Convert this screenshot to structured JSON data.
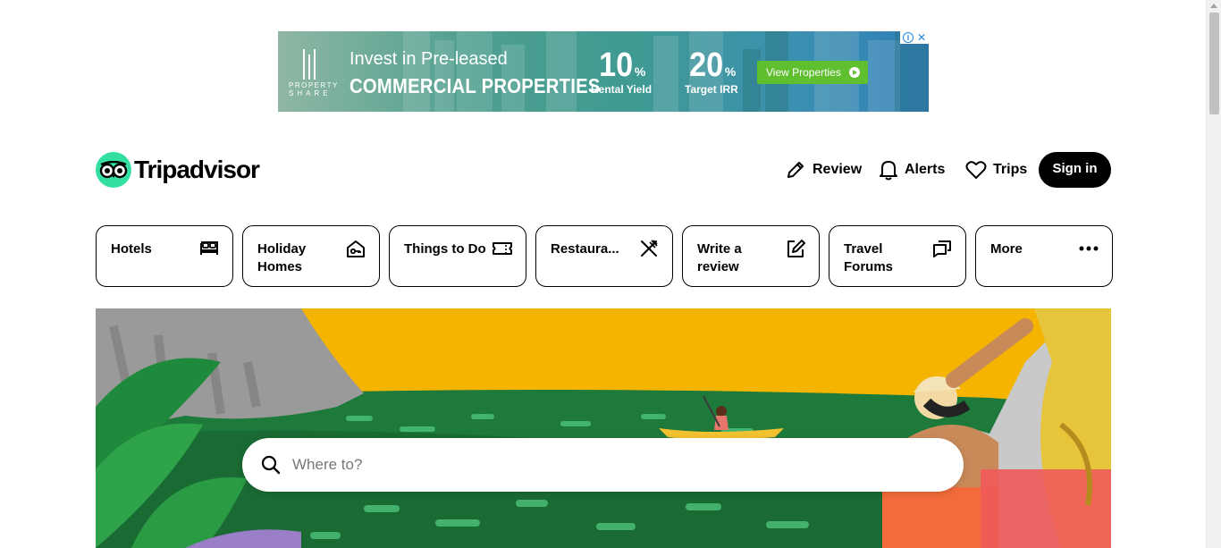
{
  "ad": {
    "line1": "Invest in Pre-leased",
    "line2": "COMMERCIAL PROPERTIES",
    "brand_line1": "PROPERTY",
    "brand_line2": "SHARE",
    "stat1": {
      "value": "10",
      "unit": "%",
      "label": "Rental Yield"
    },
    "stat2": {
      "value": "20",
      "unit": "%",
      "label": "Target IRR"
    },
    "cta_label": "View Properties",
    "adchoices_close": "✕",
    "adchoices_info": "i"
  },
  "header": {
    "brand": "Tripadvisor",
    "nav": [
      {
        "label": "Review",
        "icon": "pencil-icon"
      },
      {
        "label": "Alerts",
        "icon": "bell-icon"
      },
      {
        "label": "Trips",
        "icon": "heart-icon"
      }
    ],
    "signin_label": "Sign in"
  },
  "categories": [
    {
      "label": "Hotels",
      "icon": "bed-icon"
    },
    {
      "label": "Holiday Homes",
      "icon": "house-key-icon"
    },
    {
      "label": "Things to Do",
      "icon": "ticket-icon"
    },
    {
      "label": "Restaura...",
      "icon": "fork-knife-icon"
    },
    {
      "label": "Write a review",
      "icon": "edit-icon"
    },
    {
      "label": "Travel Forums",
      "icon": "chat-bubbles-icon"
    },
    {
      "label": "More",
      "icon": "ellipsis-icon"
    }
  ],
  "search": {
    "placeholder": "Where to?"
  },
  "colors": {
    "brand_green": "#34e0a1",
    "hero_yellow": "#f4b400",
    "cta_green": "#5fbf2e"
  }
}
